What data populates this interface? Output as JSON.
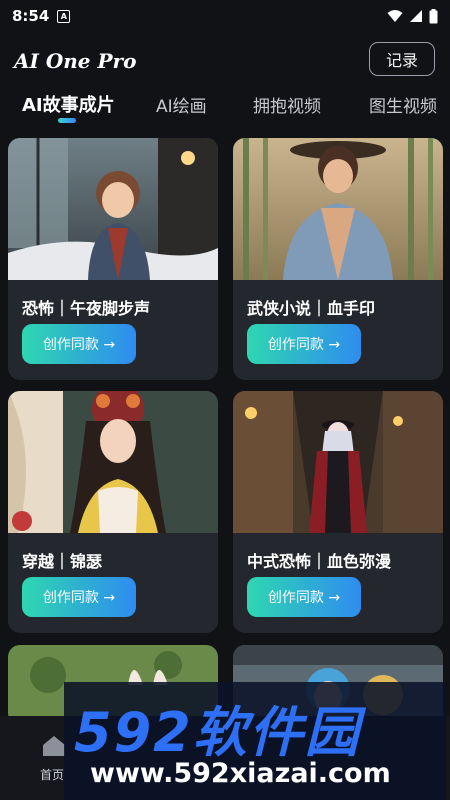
{
  "status_bar": {
    "time": "8:54",
    "notif_glyph": "A"
  },
  "header": {
    "title": "AI One Pro",
    "record_button": "记录"
  },
  "tabs": [
    {
      "label": "AI故事成片",
      "active": true
    },
    {
      "label": "AI绘画",
      "active": false
    },
    {
      "label": "拥抱视频",
      "active": false
    },
    {
      "label": "图生视频",
      "active": false
    }
  ],
  "cards": [
    {
      "title": "恐怖｜午夜脚步声",
      "button": "创作同款 →"
    },
    {
      "title": "武侠小说｜血手印",
      "button": "创作同款 →"
    },
    {
      "title": "穿越｜锦瑟",
      "button": "创作同款 →"
    },
    {
      "title": "中式恐怖｜血色弥漫",
      "button": "创作同款 →"
    }
  ],
  "bottom_nav": {
    "home_label": "首页"
  },
  "watermark": {
    "brand": "592软件园",
    "url": "www.592xiazai.com"
  },
  "colors": {
    "accent_start": "#2ed7b0",
    "accent_end": "#2f8cf0",
    "card_bg": "#24272e",
    "page_bg": "#101216"
  }
}
